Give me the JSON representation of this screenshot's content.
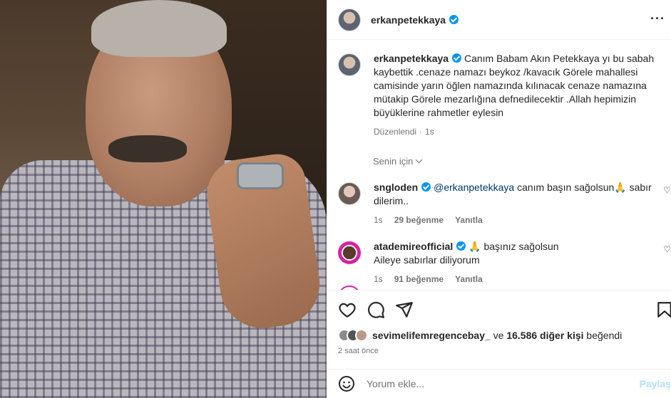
{
  "post": {
    "username": "erkanpetekkaya",
    "more_icon": "more-horizontal-icon"
  },
  "caption": {
    "username": "erkanpetekkaya",
    "text": "Canım Babam Akın Petekkaya yı bu sabah kaybettik .cenaze namazı beykoz /kavacık Görele mahallesi camisinde yarın öğlen namazında kılınacak cenaze namazına mütakip Görele mezarlığına defnedilecektir .Allah hepimizin büyüklerine rahmetler eylesin",
    "edited": "Düzenlendi",
    "time": "1s"
  },
  "filter": {
    "label": "Senin için"
  },
  "comments": [
    {
      "username": "sngloden",
      "mention": "@erkanpetekkaya",
      "text": "canım başın sağolsun🙏 sabır dilerim..",
      "time": "1s",
      "likes": "29 beğenme",
      "reply": "Yanıtla"
    },
    {
      "username": "atademireofficial",
      "text": "🙏 başınız sağolsun",
      "text2": "Aileye sabırlar diliyorum",
      "time": "1s",
      "likes": "91 beğenme",
      "reply": "Yanıtla"
    }
  ],
  "likes": {
    "user": "sevimelifemregencebay_",
    "connector": "ve",
    "others": "16.586 diğer kişi",
    "suffix": "beğendi"
  },
  "timestamp": "2 saat önce",
  "add_comment": {
    "placeholder": "Yorum ekle...",
    "post_label": "Paylaş"
  },
  "colors": {
    "verified": "#0095f6",
    "link": "#00376b",
    "muted": "#737373",
    "post_disabled": "#b2dffc"
  }
}
